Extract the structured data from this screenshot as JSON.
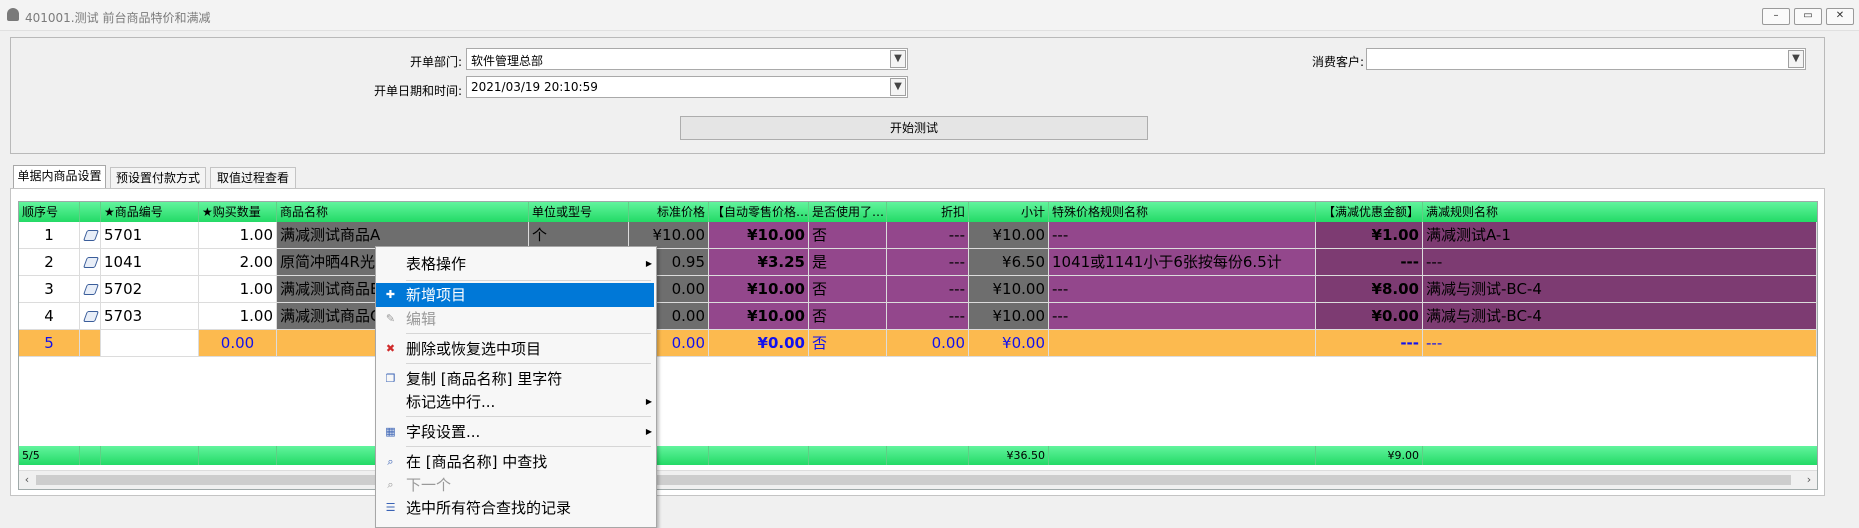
{
  "window": {
    "title": "401001.测试 前台商品特价和满减",
    "min_symbol": "–",
    "max_symbol": "▭",
    "close_symbol": "✕"
  },
  "form": {
    "dept_label": "开单部门:",
    "dept_value": "软件管理总部",
    "datetime_label": "开单日期和时间:",
    "datetime_value": "2021/03/19 20:10:59",
    "customer_label": "消费客户:",
    "customer_value": "",
    "start_button": "开始测试"
  },
  "tabs": [
    {
      "label": "单据内商品设置"
    },
    {
      "label": "预设置付款方式"
    },
    {
      "label": "取值过程查看"
    }
  ],
  "grid": {
    "columns": [
      "顺序号",
      "",
      "★商品编号",
      "★购买数量",
      "商品名称",
      "单位或型号",
      "标准价格",
      "【自动零售价格…",
      "是否使用了…",
      "折扣",
      "小计",
      "特殊价格规则名称",
      "【满减优惠金额】",
      "满减规则名称"
    ],
    "rows": [
      {
        "seq": "1",
        "code": "5701",
        "qty": "1.00",
        "name": "满减测试商品A",
        "unit": "个",
        "std": "¥10.00",
        "auto": "¥10.00",
        "used": "否",
        "disc": "---",
        "subtotal": "¥10.00",
        "special": "---",
        "mj": "¥1.00",
        "mjname": "满减测试A-1"
      },
      {
        "seq": "2",
        "code": "1041",
        "qty": "2.00",
        "name": "原简冲晒4R光面",
        "unit": "",
        "std": "0.95",
        "auto": "¥3.25",
        "used": "是",
        "disc": "---",
        "subtotal": "¥6.50",
        "special": "1041或1141小于6张按每份6.5计",
        "mj": "---",
        "mjname": "---"
      },
      {
        "seq": "3",
        "code": "5702",
        "qty": "1.00",
        "name": "满减测试商品B",
        "unit": "",
        "std": "0.00",
        "auto": "¥10.00",
        "used": "否",
        "disc": "---",
        "subtotal": "¥10.00",
        "special": "---",
        "mj": "¥8.00",
        "mjname": "满减与测试-BC-4"
      },
      {
        "seq": "4",
        "code": "5703",
        "qty": "1.00",
        "name": "满减测试商品C",
        "unit": "",
        "std": "0.00",
        "auto": "¥10.00",
        "used": "否",
        "disc": "---",
        "subtotal": "¥10.00",
        "special": "---",
        "mj": "¥0.00",
        "mjname": "满减与测试-BC-4"
      },
      {
        "seq": "5",
        "code": "",
        "qty": "0.00",
        "name": "",
        "unit": "",
        "std": "0.00",
        "auto": "¥0.00",
        "used": "否",
        "disc": "0.00",
        "subtotal": "¥0.00",
        "special": "",
        "mj": "---",
        "mjname": "---"
      }
    ],
    "footer": {
      "count": "5/5",
      "subtotal": "¥36.50",
      "mj": "¥9.00"
    }
  },
  "context_menu": {
    "items": [
      {
        "label": "表格操作",
        "submenu": true,
        "icon": "",
        "state": "normal"
      },
      {
        "label": "新增项目",
        "submenu": false,
        "icon": "add-icon",
        "state": "selected"
      },
      {
        "label": "编辑",
        "submenu": false,
        "icon": "edit-icon",
        "state": "disabled"
      },
      {
        "label": "删除或恢复选中项目",
        "submenu": false,
        "icon": "delete-icon",
        "state": "normal"
      },
      {
        "label": "复制 [商品名称] 里字符",
        "submenu": false,
        "icon": "copy-icon",
        "state": "normal"
      },
      {
        "label": "标记选中行...",
        "submenu": true,
        "icon": "",
        "state": "normal"
      },
      {
        "label": "字段设置...",
        "submenu": true,
        "icon": "table-icon",
        "state": "normal"
      },
      {
        "label": "在 [商品名称] 中查找",
        "submenu": false,
        "icon": "find-icon",
        "state": "normal"
      },
      {
        "label": "下一个",
        "submenu": false,
        "icon": "find-next-icon",
        "state": "disabled"
      },
      {
        "label": "选中所有符合查找的记录",
        "submenu": false,
        "icon": "select-all-icon",
        "state": "normal"
      }
    ]
  },
  "colors": {
    "header_green": "#2ee374",
    "gray_cell": "#6e6e6e",
    "purple_cell": "#93478c",
    "orange_row": "#fcba4f",
    "menu_highlight": "#0078d7"
  }
}
